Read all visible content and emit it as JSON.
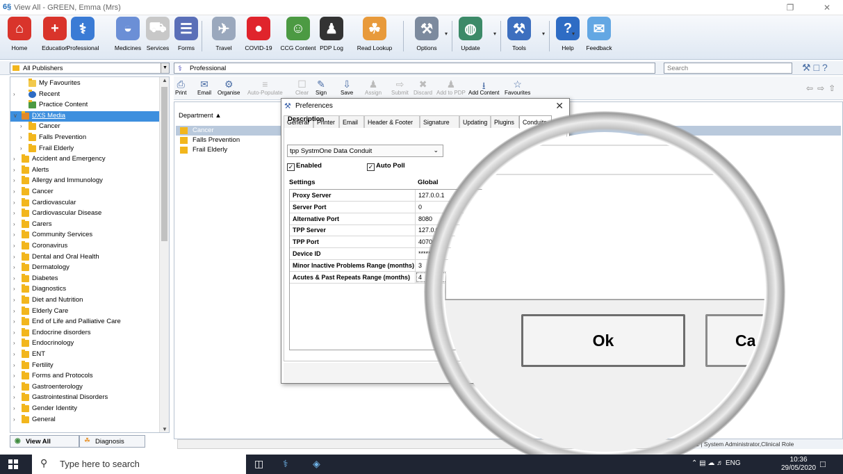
{
  "window": {
    "logo": "6§",
    "title": "View All - GREEN, Emma (Mrs)"
  },
  "ribbon": {
    "items": [
      {
        "label": "Home",
        "icon": "home-icon",
        "color": "#d9342b",
        "glyph": "⌂"
      },
      {
        "label": "Education",
        "icon": "first-aid-icon",
        "color": "#d9342b",
        "glyph": "+"
      },
      {
        "label": "Professional",
        "icon": "caduceus-icon",
        "color": "#3a7bd5",
        "glyph": "⚕"
      },
      {
        "label": "Medicines",
        "icon": "pill-icon",
        "color": "#6b8fd6",
        "glyph": "◒"
      },
      {
        "label": "Services",
        "icon": "ambulance-icon",
        "color": "#c8c8c8",
        "glyph": "⛟"
      },
      {
        "label": "Forms",
        "icon": "forms-icon",
        "color": "#5a6fb8",
        "glyph": "☰"
      },
      {
        "label": "Travel",
        "icon": "plane-icon",
        "color": "#9aa8bd",
        "glyph": "✈"
      },
      {
        "label": "COVID-19",
        "icon": "siren-icon",
        "color": "#e0242c",
        "glyph": "●"
      },
      {
        "label": "CCG Content",
        "icon": "people-icon",
        "color": "#4c9a43",
        "glyph": "☺"
      },
      {
        "label": "PDP Log",
        "icon": "graduate-icon",
        "color": "#333333",
        "glyph": "♟"
      },
      {
        "label": "Read Lookup",
        "icon": "stethoscope-icon",
        "color": "#e89a3b",
        "glyph": "☘"
      },
      {
        "label": "Options",
        "icon": "tools-icon",
        "color": "#7c8a9e",
        "glyph": "⚒"
      },
      {
        "label": "Update",
        "icon": "globe-icon",
        "color": "#3c8a68",
        "glyph": "◍"
      },
      {
        "label": "Tools",
        "icon": "wrench-icon",
        "color": "#3d6fbf",
        "glyph": "⚒"
      },
      {
        "label": "Help",
        "icon": "help-book-icon",
        "color": "#2e6cc4",
        "glyph": "?"
      },
      {
        "label": "Feedback",
        "icon": "speech-bubble-icon",
        "color": "#63a7e3",
        "glyph": "✉"
      }
    ]
  },
  "filter": {
    "publisher": "All Publishers",
    "breadcrumb": "Professional",
    "search_placeholder": "Search"
  },
  "tree": {
    "items": [
      {
        "label": "My Favourites",
        "type": "star",
        "indent": 1
      },
      {
        "label": "Recent",
        "type": "recent",
        "indent": 1
      },
      {
        "label": "Practice Content",
        "type": "practice",
        "indent": 1
      },
      {
        "label": "DXS Media",
        "type": "media",
        "indent": 0,
        "selected": true
      },
      {
        "label": "Cancer",
        "type": "folder",
        "indent": 1
      },
      {
        "label": "Falls Prevention",
        "type": "folder",
        "indent": 1
      },
      {
        "label": "Frail Elderly",
        "type": "folder",
        "indent": 1
      },
      {
        "label": "Accident and Emergency",
        "type": "folder",
        "indent": 0
      },
      {
        "label": "Alerts",
        "type": "folder",
        "indent": 0
      },
      {
        "label": "Allergy and Immunology",
        "type": "folder",
        "indent": 0
      },
      {
        "label": "Cancer",
        "type": "folder",
        "indent": 0
      },
      {
        "label": "Cardiovascular",
        "type": "folder",
        "indent": 0
      },
      {
        "label": "Cardiovascular Disease",
        "type": "folder",
        "indent": 0
      },
      {
        "label": "Carers",
        "type": "folder",
        "indent": 0
      },
      {
        "label": "Community Services",
        "type": "folder",
        "indent": 0
      },
      {
        "label": "Coronavirus",
        "type": "folder",
        "indent": 0
      },
      {
        "label": "Dental and Oral Health",
        "type": "folder",
        "indent": 0
      },
      {
        "label": "Dermatology",
        "type": "folder",
        "indent": 0
      },
      {
        "label": "Diabetes",
        "type": "folder",
        "indent": 0
      },
      {
        "label": "Diagnostics",
        "type": "folder",
        "indent": 0
      },
      {
        "label": "Diet and Nutrition",
        "type": "folder",
        "indent": 0
      },
      {
        "label": "Elderly Care",
        "type": "folder",
        "indent": 0
      },
      {
        "label": "End of Life and Palliative Care",
        "type": "folder",
        "indent": 0
      },
      {
        "label": "Endocrine disorders",
        "type": "folder",
        "indent": 0
      },
      {
        "label": "Endocrinology",
        "type": "folder",
        "indent": 0
      },
      {
        "label": "ENT",
        "type": "folder",
        "indent": 0
      },
      {
        "label": "Fertility",
        "type": "folder",
        "indent": 0
      },
      {
        "label": "Forms and Protocols",
        "type": "folder",
        "indent": 0
      },
      {
        "label": "Gastroenterology",
        "type": "folder",
        "indent": 0
      },
      {
        "label": "Gastrointestinal Disorders",
        "type": "folder",
        "indent": 0
      },
      {
        "label": "Gender Identity",
        "type": "folder",
        "indent": 0
      },
      {
        "label": "General",
        "type": "folder",
        "indent": 0
      }
    ]
  },
  "bottom_tabs": {
    "view_all": "View All",
    "diagnosis": "Diagnosis"
  },
  "toolbar": {
    "items": [
      {
        "label": "Print",
        "icon": "printer-icon",
        "glyph": "⎙",
        "disabled": false
      },
      {
        "label": "Email",
        "icon": "envelope-icon",
        "glyph": "✉",
        "disabled": false
      },
      {
        "label": "Organise",
        "icon": "organise-icon",
        "glyph": "⚙",
        "disabled": false
      },
      {
        "label": "Auto-Populate",
        "icon": "auto-populate-icon",
        "glyph": "≡",
        "disabled": true
      },
      {
        "label": "Clear",
        "icon": "clear-icon",
        "glyph": "☐",
        "disabled": true
      },
      {
        "label": "Sign",
        "icon": "pen-icon",
        "glyph": "✎",
        "disabled": false
      },
      {
        "label": "Save",
        "icon": "save-icon",
        "glyph": "⇩",
        "disabled": false
      },
      {
        "label": "Assign",
        "icon": "assign-icon",
        "glyph": "♟",
        "disabled": true
      },
      {
        "label": "Submit",
        "icon": "submit-icon",
        "glyph": "⇨",
        "disabled": true
      },
      {
        "label": "Discard",
        "icon": "discard-icon",
        "glyph": "✖",
        "disabled": true
      },
      {
        "label": "Add to PDP",
        "icon": "add-pdp-icon",
        "glyph": "♟",
        "disabled": true
      },
      {
        "label": "Add Content",
        "icon": "add-content-icon",
        "glyph": "⭳",
        "disabled": false
      },
      {
        "label": "Favourites",
        "icon": "favourites-star-icon",
        "glyph": "☆",
        "disabled": false
      }
    ]
  },
  "content": {
    "column_header": "Department",
    "rows": [
      {
        "label": "Cancer",
        "selected": true
      },
      {
        "label": "Falls Prevention",
        "selected": false
      },
      {
        "label": "Frail Elderly",
        "selected": false
      }
    ]
  },
  "status": {
    "text": "ment 1 | System Administrator,Clinical Role"
  },
  "dialog": {
    "title": "Preferences",
    "tabs": [
      "General",
      "Printer",
      "Email",
      "Header & Footer",
      "Signature",
      "Updating",
      "Plugins",
      "Conduits"
    ],
    "active_tab": "Conduits",
    "description_label": "Description",
    "description_value": "tpp SystmOne Data Conduit",
    "enabled_label": "Enabled",
    "enabled_checked": true,
    "autopoll_label": "Auto Poll",
    "autopoll_checked": true,
    "settings_header": "Settings",
    "global_header": "Global",
    "settings": [
      {
        "key": "Proxy Server",
        "value": "127.0.0.1"
      },
      {
        "key": "Server Port",
        "value": "0"
      },
      {
        "key": "Alternative Port",
        "value": "8080"
      },
      {
        "key": "TPP Server",
        "value": "127.0.0.1"
      },
      {
        "key": "TPP Port",
        "value": "40700"
      },
      {
        "key": "Device ID",
        "value": "*****"
      },
      {
        "key": "Minor Inactive Problems Range (months)",
        "value": "3"
      },
      {
        "key": "Acutes & Past Repeats Range (months)",
        "value": "4"
      }
    ]
  },
  "magnifier": {
    "ok_label": "Ok",
    "cancel_label": "Ca"
  },
  "taskbar": {
    "search_placeholder": "Type here to search",
    "language": "ENG",
    "time": "10:36",
    "date": "29/05/2020"
  }
}
